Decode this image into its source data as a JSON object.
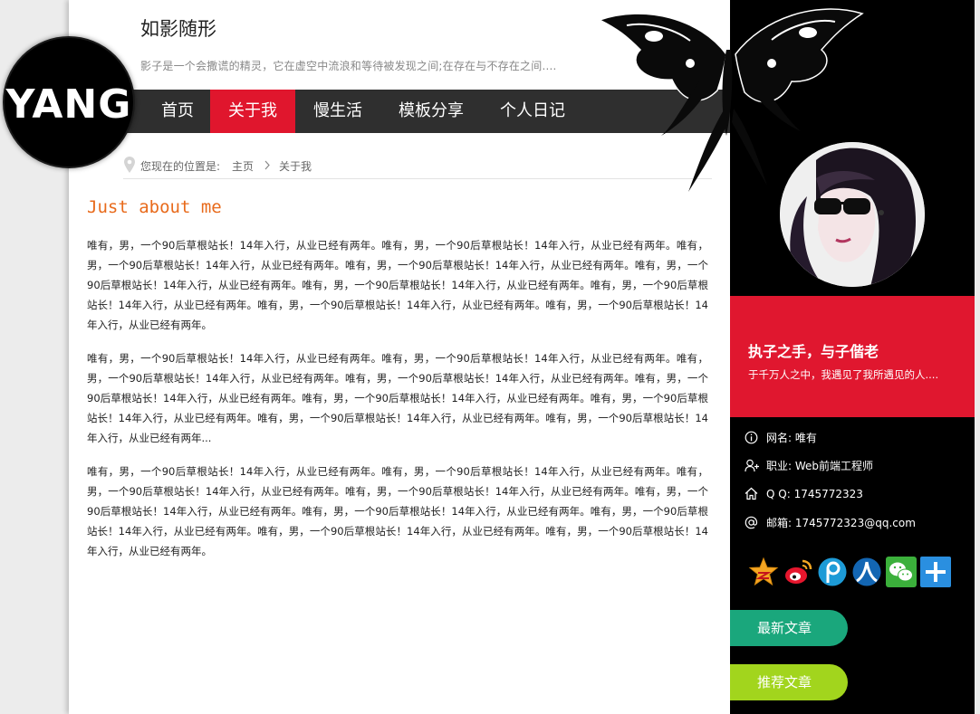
{
  "header": {
    "site_title": "如影随形",
    "site_subtitle": "影子是一个会撒谎的精灵，它在虚空中流浪和等待被发现之间;在存在与不存在之间....",
    "logo_text": "YANG"
  },
  "nav": {
    "items": [
      {
        "label": "首页"
      },
      {
        "label": "关于我",
        "active": true
      },
      {
        "label": "慢生活"
      },
      {
        "label": "模板分享"
      },
      {
        "label": "个人日记"
      }
    ]
  },
  "breadcrumb": {
    "prefix": "您现在的位置是:",
    "home": "主页",
    "current": "关于我"
  },
  "main": {
    "title": "Just about me",
    "paragraphs": [
      "唯有，男，一个90后草根站长！14年入行，从业已经有两年。唯有，男，一个90后草根站长！14年入行，从业已经有两年。唯有，男，一个90后草根站长！14年入行，从业已经有两年。唯有，男，一个90后草根站长！14年入行，从业已经有两年。唯有，男，一个90后草根站长！14年入行，从业已经有两年。唯有，男，一个90后草根站长！14年入行，从业已经有两年。唯有，男，一个90后草根站长！14年入行，从业已经有两年。唯有，男，一个90后草根站长！14年入行，从业已经有两年。唯有，男，一个90后草根站长！14年入行，从业已经有两年。",
      "唯有，男，一个90后草根站长！14年入行，从业已经有两年。唯有，男，一个90后草根站长！14年入行，从业已经有两年。唯有，男，一个90后草根站长！14年入行，从业已经有两年。唯有，男，一个90后草根站长！14年入行，从业已经有两年。唯有，男，一个90后草根站长！14年入行，从业已经有两年。唯有，男，一个90后草根站长！14年入行，从业已经有两年。唯有，男，一个90后草根站长！14年入行，从业已经有两年。唯有，男，一个90后草根站长！14年入行，从业已经有两年。唯有，男，一个90后草根站长！14年入行，从业已经有两年...",
      "唯有，男，一个90后草根站长！14年入行，从业已经有两年。唯有，男，一个90后草根站长！14年入行，从业已经有两年。唯有，男，一个90后草根站长！14年入行，从业已经有两年。唯有，男，一个90后草根站长！14年入行，从业已经有两年。唯有，男，一个90后草根站长！14年入行，从业已经有两年。唯有，男，一个90后草根站长！14年入行，从业已经有两年。唯有，男，一个90后草根站长！14年入行，从业已经有两年。唯有，男，一个90后草根站长！14年入行，从业已经有两年。唯有，男，一个90后草根站长！14年入行，从业已经有两年。"
    ]
  },
  "sidebar": {
    "motto": "执子之手，与子偕老",
    "motto_sub": "于千万人之中，我遇见了我所遇见的人....",
    "info": {
      "name": "网名: 唯有",
      "job": "职业: Web前端工程师",
      "qq": "Q Q: 1745772323",
      "email": "邮箱: 1745772323@qq.com"
    },
    "social_icons": [
      "qzone-icon",
      "weibo-icon",
      "pengyou-icon",
      "renren-icon",
      "wechat-icon",
      "more-share-icon"
    ],
    "latest_label": "最新文章",
    "recommend_label": "推荐文章"
  },
  "colors": {
    "accent_red": "#e0162d",
    "nav_bg": "#2f2f2f",
    "title_orange": "#e86a1b",
    "latest_green": "#1aa77c",
    "recommend_lime": "#a2d51d"
  }
}
